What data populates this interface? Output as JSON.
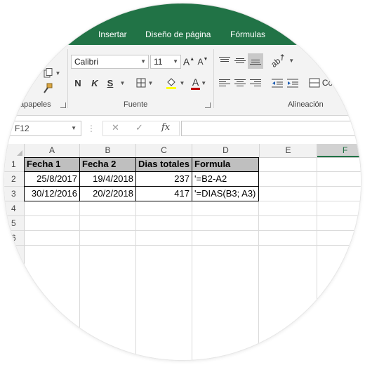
{
  "ribbon": {
    "tabs": [
      "Insertar",
      "Diseño de página",
      "Fórmulas"
    ],
    "groups": {
      "clipboard": "apapeles",
      "font": "Fuente",
      "alignment": "Alineación"
    },
    "font_name": "Calibri",
    "font_size": "11",
    "bold": "N",
    "italic": "K",
    "underline": "S",
    "grow_font": "A",
    "shrink_font": "A",
    "font_color": "A",
    "combine_partial": "Co"
  },
  "formula_bar": {
    "name_box": "F12",
    "fx": "fx",
    "cancel": "✕",
    "enter": "✓",
    "content": ""
  },
  "sheet": {
    "columns": [
      "A",
      "B",
      "C",
      "D",
      "E",
      "F"
    ],
    "selected_column": "F",
    "rows": [
      "1",
      "2",
      "3",
      "4",
      "5",
      "6"
    ],
    "cells": {
      "r1": [
        "Fecha 1",
        "Fecha 2",
        "Dias totales",
        "Formula"
      ],
      "r2": [
        "25/8/2017",
        "19/4/2018",
        "237",
        "'=B2-A2"
      ],
      "r3": [
        "30/12/2016",
        "20/2/2018",
        "417",
        "'=DIAS(B3; A3)"
      ]
    }
  },
  "colors": {
    "excel_green": "#217346",
    "header_fill": "#bfbfbf",
    "font_color_bar": "#c00000",
    "fill_color_bar": "#ffff00"
  }
}
